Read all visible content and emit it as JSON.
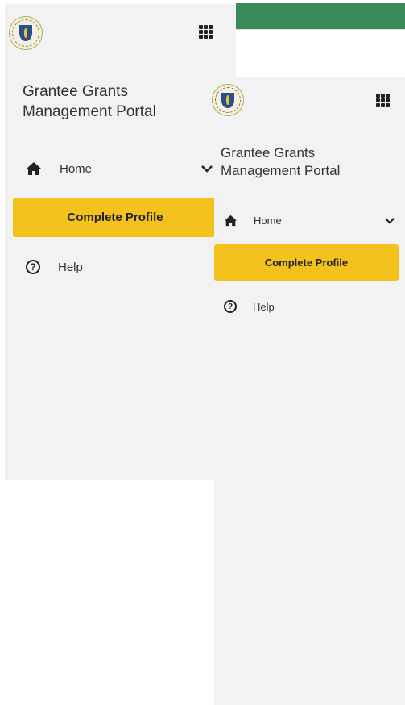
{
  "colors": {
    "accent": "#f4c21d",
    "header_green": "#3a8a5a",
    "panel_bg": "#f2f2f2"
  },
  "back_panel": {
    "title_line1": "Grantee Grants",
    "title_line2": "Management Portal",
    "nav": {
      "home_label": "Home",
      "home_icon": "home-icon",
      "expand_icon": "chevron-down-icon"
    },
    "complete_profile_label": "Complete Profile",
    "help_label": "Help",
    "help_icon_glyph": "?"
  },
  "front_panel": {
    "title_line1": "Grantee Grants",
    "title_line2": "Management Portal",
    "nav": {
      "home_label": "Home",
      "home_icon": "home-icon",
      "expand_icon": "chevron-down-icon"
    },
    "complete_profile_label": "Complete Profile",
    "help_label": "Help",
    "help_icon_glyph": "?"
  }
}
